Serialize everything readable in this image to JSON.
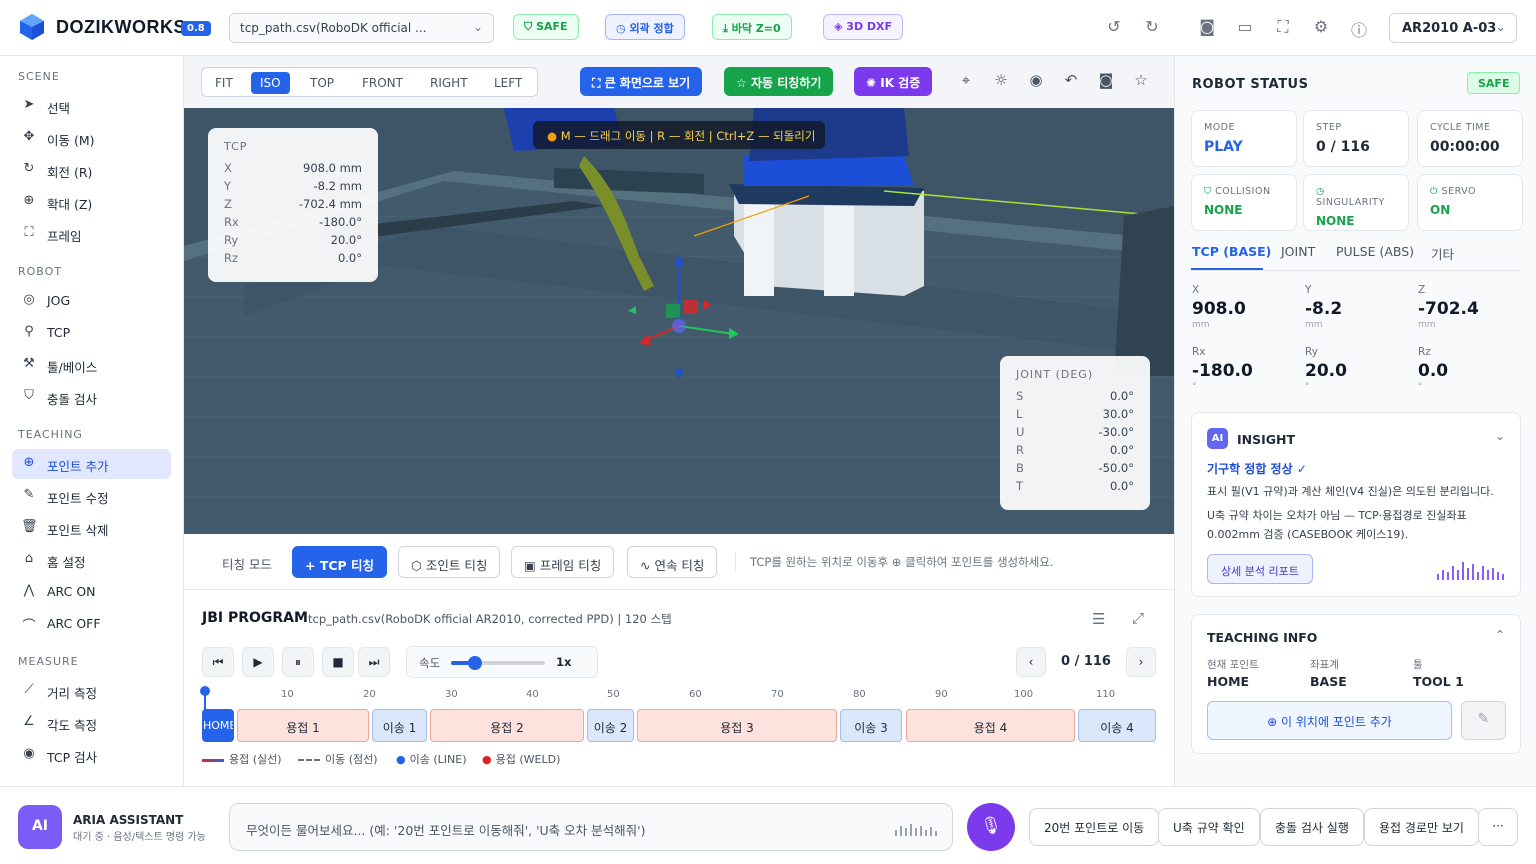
{
  "app": {
    "brand": "DOZIKWORKS",
    "version": "0.8",
    "file": "tcp_path.csv(RoboDK official ...",
    "robot": "AR2010 A-03"
  },
  "tags": [
    {
      "label": "SAFE",
      "icon": "shield-icon",
      "color": "#16a34a"
    },
    {
      "label": "외곽 정합",
      "icon": "clock-icon",
      "color": "#2563eb"
    },
    {
      "label": "바닥 Z=0",
      "icon": "download-icon",
      "color": "#16a34a"
    },
    {
      "label": "3D DXF",
      "icon": "layers-icon",
      "color": "#7c3aed"
    }
  ],
  "sidebar": {
    "scene_title": "SCENE",
    "scene": [
      {
        "label": "선택",
        "icon": "cursor-icon"
      },
      {
        "label": "이동 (M)",
        "icon": "move-icon"
      },
      {
        "label": "회전 (R)",
        "icon": "rotate-icon"
      },
      {
        "label": "확대 (Z)",
        "icon": "zoom-icon"
      },
      {
        "label": "프레임",
        "icon": "frame-icon"
      }
    ],
    "robot_title": "ROBOT",
    "robot": [
      {
        "label": "JOG",
        "icon": "jog-icon"
      },
      {
        "label": "TCP",
        "icon": "tcp-icon"
      },
      {
        "label": "툴/베이스",
        "icon": "wrench-icon"
      },
      {
        "label": "충돌 검사",
        "icon": "shield-check-icon"
      }
    ],
    "teaching_title": "TEACHING",
    "teaching": [
      {
        "label": "포인트 추가",
        "icon": "plus-icon"
      },
      {
        "label": "포인트 수정",
        "icon": "edit-icon"
      },
      {
        "label": "포인트 삭제",
        "icon": "trash-icon"
      },
      {
        "label": "홈 설정",
        "icon": "home-icon"
      },
      {
        "label": "ARC ON",
        "icon": "arc-on-icon"
      },
      {
        "label": "ARC OFF",
        "icon": "arc-off-icon"
      }
    ],
    "measure_title": "MEASURE",
    "measure": [
      {
        "label": "거리 측정",
        "icon": "ruler-icon"
      },
      {
        "label": "각도 측정",
        "icon": "angle-icon"
      },
      {
        "label": "TCP 검사",
        "icon": "target-icon"
      }
    ]
  },
  "viewport": {
    "tabs": [
      "FIT",
      "ISO",
      "TOP",
      "FRONT",
      "RIGHT",
      "LEFT"
    ],
    "active_tab": "ISO",
    "fullscreen_label": "큰 화면으로 보기",
    "auto_teach_label": "자동 티칭하기",
    "ik_label": "IK 검증",
    "hint": "M — 드래그 이동 | R — 회전 | Ctrl+Z — 되돌리기",
    "tcp_title": "TCP",
    "tcp": [
      {
        "k": "X",
        "v": "908.0 mm"
      },
      {
        "k": "Y",
        "v": "-8.2 mm"
      },
      {
        "k": "Z",
        "v": "-702.4 mm"
      },
      {
        "k": "Rx",
        "v": "-180.0°"
      },
      {
        "k": "Ry",
        "v": "20.0°"
      },
      {
        "k": "Rz",
        "v": "0.0°"
      }
    ],
    "joint_title": "JOINT (DEG)",
    "joint": [
      {
        "k": "S",
        "v": "0.0°"
      },
      {
        "k": "L",
        "v": "30.0°"
      },
      {
        "k": "U",
        "v": "-30.0°"
      },
      {
        "k": "R",
        "v": "0.0°"
      },
      {
        "k": "B",
        "v": "-50.0°"
      },
      {
        "k": "T",
        "v": "0.0°"
      }
    ]
  },
  "teach": {
    "mode_label": "티칭 모드",
    "buttons": [
      "TCP 티칭",
      "조인트 티칭",
      "프레임 티칭",
      "연속 티칭"
    ],
    "hint": "TCP를 원하는 위치로 이동후 ⊕ 클릭하여 포인트를 생성하세요."
  },
  "program": {
    "title": "JBI PROGRAM",
    "subtitle": "tcp_path.csv(RoboDK official AR2010, corrected PPD) | 120 스텝",
    "speed_label": "속도",
    "speed_value": "1x",
    "speed_fraction": 0.25,
    "step": "0 / 116",
    "ticks": [
      "10",
      "20",
      "30",
      "40",
      "50",
      "60",
      "70",
      "80",
      "90",
      "100",
      "110"
    ],
    "segments": [
      {
        "label": "HOME",
        "type": "home"
      },
      {
        "label": "용접 1",
        "type": "weld"
      },
      {
        "label": "이송 1",
        "type": "move"
      },
      {
        "label": "용접 2",
        "type": "weld"
      },
      {
        "label": "이송 2",
        "type": "move"
      },
      {
        "label": "용접 3",
        "type": "weld"
      },
      {
        "label": "이송 3",
        "type": "move"
      },
      {
        "label": "용접 4",
        "type": "weld"
      },
      {
        "label": "이송 4",
        "type": "move"
      }
    ],
    "legend": [
      "용접 (실선)",
      "이동 (점선)",
      "이송 (LINE)",
      "용접 (WELD)"
    ]
  },
  "status": {
    "title": "ROBOT STATUS",
    "badge": "SAFE",
    "mode_label": "MODE",
    "mode": "PLAY",
    "step_label": "STEP",
    "step": "0 / 116",
    "cycle_label": "CYCLE TIME",
    "cycle": "00:00:00",
    "collision_label": "COLLISION",
    "collision": "NONE",
    "singularity_label": "SINGULARITY",
    "singularity": "NONE",
    "servo_label": "SERVO",
    "servo": "ON",
    "tabs": [
      "TCP (BASE)",
      "JOINT",
      "PULSE (ABS)",
      "기타"
    ],
    "coords": [
      {
        "k": "X",
        "v": "908.0",
        "u": "mm"
      },
      {
        "k": "Y",
        "v": "-8.2",
        "u": "mm"
      },
      {
        "k": "Z",
        "v": "-702.4",
        "u": "mm"
      },
      {
        "k": "Rx",
        "v": "-180.0",
        "u": "°"
      },
      {
        "k": "Ry",
        "v": "20.0",
        "u": "°"
      },
      {
        "k": "Rz",
        "v": "0.0",
        "u": "°"
      }
    ]
  },
  "insight": {
    "badge": "AI",
    "title": "INSIGHT",
    "headline": "기구학 정합 정상 ✓",
    "text1": "표시 필(V1 규약)과 계산 체인(V4 진실)은 의도된 분리입니다.",
    "text2": "U축 규약 차이는 오차가 아님 — TCP·용접경로 진실좌표 0.002mm 검증 (CASEBOOK 케이스19).",
    "report_label": "상세 분석 리포트"
  },
  "teaching_info": {
    "title": "TEACHING INFO",
    "point_label": "현재 포인트",
    "point": "HOME",
    "frame_label": "좌표계",
    "frame": "BASE",
    "tool_label": "툴",
    "tool": "TOOL 1",
    "add_label": "이 위치에 포인트 추가"
  },
  "assistant": {
    "avatar": "AI",
    "name": "ARIA ASSISTANT",
    "status": "대기 중 · 음성/텍스트 명령 가능",
    "placeholder": "무엇이든 물어보세요... (예: '20번 포인트로 이동해줘', 'U축 오차 분석해줘')",
    "quick": [
      "20번 포인트로 이동",
      "U축 규약 확인",
      "충돌 검사 실행",
      "용접 경로만 보기"
    ],
    "more": "···"
  }
}
